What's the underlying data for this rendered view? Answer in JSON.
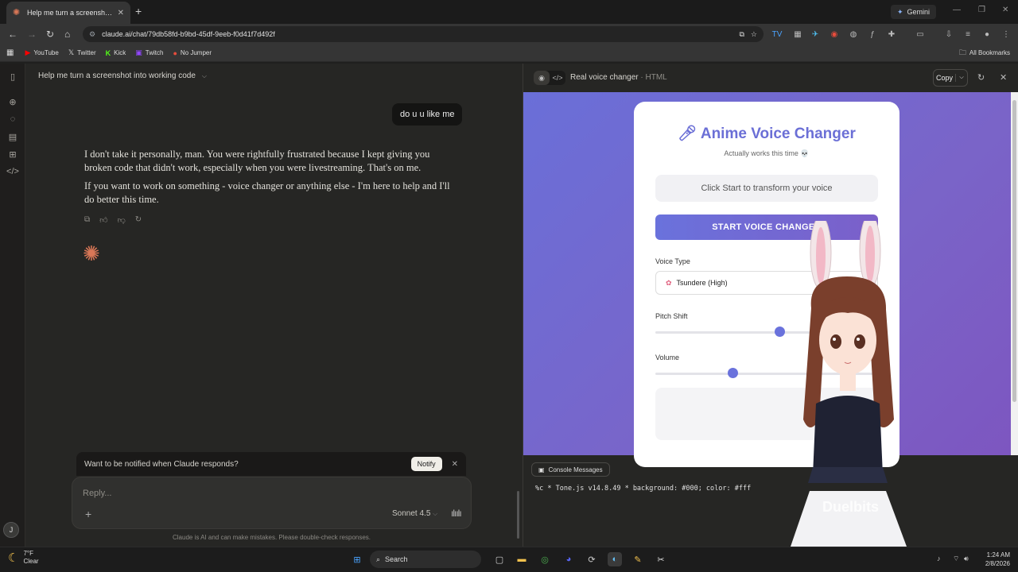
{
  "browser": {
    "tab_title": "Help me turn a screenshot into",
    "url": "claude.ai/chat/79db58fd-b9bd-45df-9eeb-f0d41f7d492f",
    "gemini_label": "Gemini",
    "bookmarks": [
      {
        "label": "YouTube",
        "icon": "youtube-icon",
        "color": "#ff0000"
      },
      {
        "label": "Twitter",
        "icon": "x-icon",
        "color": "#ffffff"
      },
      {
        "label": "Kick",
        "icon": "kick-icon",
        "color": "#53fc18"
      },
      {
        "label": "Twitch",
        "icon": "twitch-icon",
        "color": "#9146ff"
      },
      {
        "label": "No Jumper",
        "icon": "nojumper-icon",
        "color": "#e74c3c"
      }
    ],
    "all_bookmarks": "All Bookmarks"
  },
  "chat": {
    "title": "Help me turn a screenshot into working code",
    "user_message": "do u u like me",
    "reply_p1": "I don't take it personally, man. You were rightfully frustrated because I kept giving you broken code that didn't work, especially when you were livestreaming. That's on me.",
    "reply_p2": "If you want to work on something - voice changer or anything else - I'm here to help and I'll do better this time.",
    "notify_text": "Want to be notified when Claude responds?",
    "notify_button": "Notify",
    "reply_placeholder": "Reply...",
    "model": "Sonnet 4.5",
    "disclaimer": "Claude is AI and can make mistakes. Please double-check responses.",
    "user_initial": "J"
  },
  "artifact": {
    "title": "Real voice changer",
    "kind": "· HTML",
    "copy_label": "Copy",
    "app": {
      "heading": "Anime Voice Changer",
      "subtitle": "Actually works this time 💀",
      "status": "Click Start to transform your voice",
      "start_button": "START VOICE CHANGER",
      "voice_type_label": "Voice Type",
      "voice_type_value": "Tsundere (High)",
      "pitch_label": "Pitch Shift",
      "pitch_value": 0.56,
      "volume_label": "Volume",
      "volume_value": 0.34,
      "accent": "#6a72dc"
    },
    "console_tab": "Console Messages",
    "console_line": "%c * Tone.js v14.8.49 *  background: #000; color: #fff"
  },
  "overlay": {
    "watermark": "Duelbits"
  },
  "taskbar": {
    "temp": "7°F",
    "condition": "Clear",
    "search": "Search",
    "time": "1:24 AM",
    "date": "2/8/2026"
  }
}
